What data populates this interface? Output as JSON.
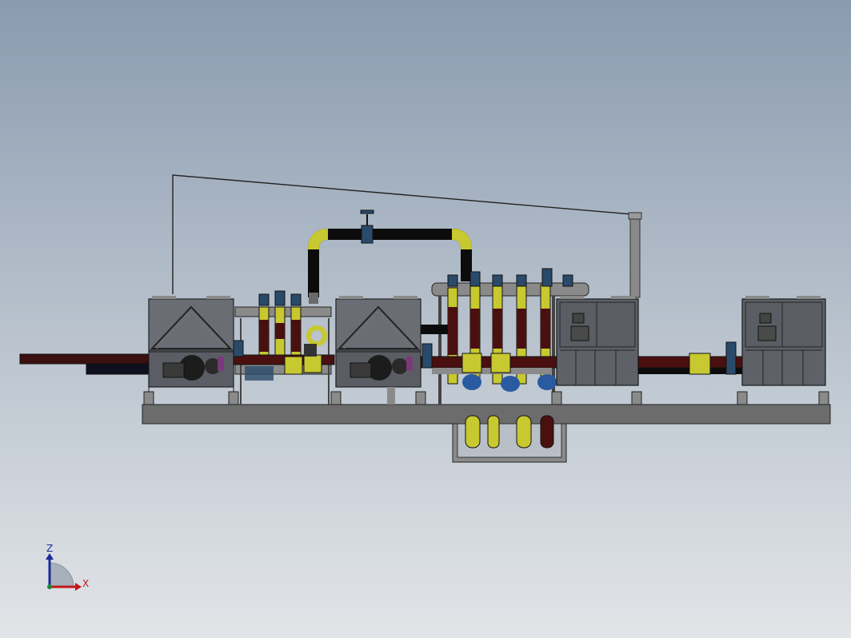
{
  "triad": {
    "z_label": "Z",
    "x_label": "X",
    "z_color": "#1a2a9a",
    "x_color": "#c01818"
  },
  "colors": {
    "pipe_yellow": "#c8c830",
    "pipe_black": "#0c0c0c",
    "pipe_maroon": "#4a1010",
    "pipe_grey": "#7f7f7f",
    "unit_body": "#5e6268",
    "valve_blue": "#2a4a6a",
    "base_frame": "#6e6e6e"
  }
}
